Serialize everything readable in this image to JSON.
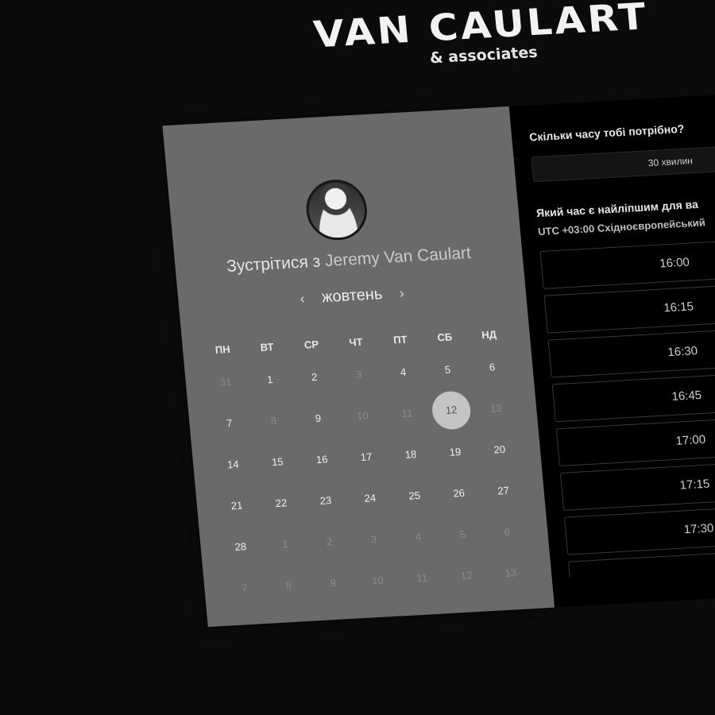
{
  "brand": {
    "name": "VAN CAULART",
    "sub": "& associates"
  },
  "left": {
    "title_prefix": "Зустрітися з",
    "host": "Jeremy Van Caulart",
    "month": "жовтень",
    "prev": "‹",
    "next": "›",
    "weekdays": [
      "ПН",
      "ВТ",
      "СР",
      "ЧТ",
      "ПТ",
      "СБ",
      "НД"
    ],
    "weeks": [
      [
        {
          "d": "31",
          "m": true
        },
        {
          "d": "1",
          "m": false
        },
        {
          "d": "2",
          "m": false
        },
        {
          "d": "3",
          "m": true
        },
        {
          "d": "4",
          "m": false
        },
        {
          "d": "5",
          "m": false
        },
        {
          "d": "6",
          "m": false
        }
      ],
      [
        {
          "d": "7",
          "m": false
        },
        {
          "d": "8",
          "m": true
        },
        {
          "d": "9",
          "m": false
        },
        {
          "d": "10",
          "m": true
        },
        {
          "d": "11",
          "m": true
        },
        {
          "d": "12",
          "m": false,
          "sel": true
        },
        {
          "d": "13",
          "m": true
        }
      ],
      [
        {
          "d": "14",
          "m": false
        },
        {
          "d": "15",
          "m": false
        },
        {
          "d": "16",
          "m": false
        },
        {
          "d": "17",
          "m": false
        },
        {
          "d": "18",
          "m": false
        },
        {
          "d": "19",
          "m": false
        },
        {
          "d": "20",
          "m": false
        }
      ],
      [
        {
          "d": "21",
          "m": false
        },
        {
          "d": "22",
          "m": false
        },
        {
          "d": "23",
          "m": false
        },
        {
          "d": "24",
          "m": false
        },
        {
          "d": "25",
          "m": false
        },
        {
          "d": "26",
          "m": false
        },
        {
          "d": "27",
          "m": false
        }
      ],
      [
        {
          "d": "28",
          "m": false
        },
        {
          "d": "1",
          "m": true
        },
        {
          "d": "2",
          "m": true
        },
        {
          "d": "3",
          "m": true
        },
        {
          "d": "4",
          "m": true
        },
        {
          "d": "5",
          "m": true
        },
        {
          "d": "6",
          "m": true
        }
      ],
      [
        {
          "d": "7",
          "m": true
        },
        {
          "d": "8",
          "m": true
        },
        {
          "d": "9",
          "m": true
        },
        {
          "d": "10",
          "m": true
        },
        {
          "d": "11",
          "m": true
        },
        {
          "d": "12",
          "m": true
        },
        {
          "d": "13",
          "m": true
        }
      ]
    ]
  },
  "right": {
    "duration_question": "Скільки часу тобі потрібно?",
    "duration_value": "30 хвилин",
    "time_question": "Який час є найліпшим для ва",
    "timezone": "UTC +03:00 Східноєвропейський",
    "slots": [
      "16:00",
      "16:15",
      "16:30",
      "16:45",
      "17:00",
      "17:15",
      "17:30",
      ""
    ]
  },
  "colors": {
    "page_bg": "#0b0b0b",
    "left_panel": "#6a6a6a",
    "right_panel": "#000000",
    "selected_day": "#c4c4c4"
  }
}
